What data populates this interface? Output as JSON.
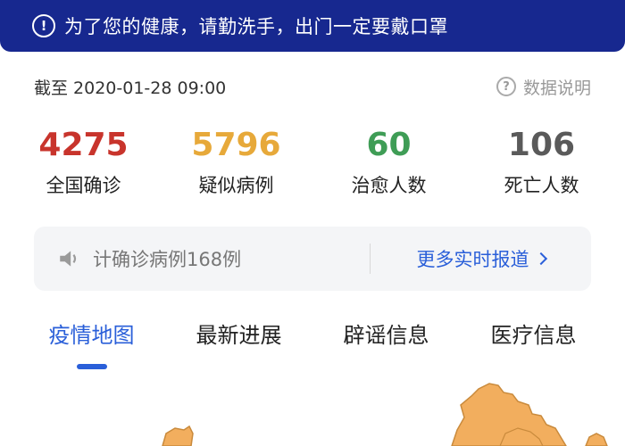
{
  "banner": {
    "icon": "exclamation-circle-icon",
    "text": "为了您的健康，请勤洗手，出门一定要戴口罩"
  },
  "meta": {
    "updated": "截至 2020-01-28 09:00",
    "explain_label": "数据说明"
  },
  "stats": [
    {
      "value": "4275",
      "label": "全国确诊",
      "color": "#c8342c"
    },
    {
      "value": "5796",
      "label": "疑似病例",
      "color": "#e7a93a"
    },
    {
      "value": "60",
      "label": "治愈人数",
      "color": "#3f9d56"
    },
    {
      "value": "106",
      "label": "死亡人数",
      "color": "#5a5a5a"
    }
  ],
  "ticker": {
    "text": "计确诊病例168例",
    "more_label": "更多实时报道"
  },
  "tabs": [
    {
      "label": "疫情地图",
      "active": true
    },
    {
      "label": "最新进展",
      "active": false
    },
    {
      "label": "辟谣信息",
      "active": false
    },
    {
      "label": "医疗信息",
      "active": false
    }
  ],
  "colors": {
    "banner_bg": "#17288f",
    "accent": "#2a5fd9",
    "map_fill": "#f2ae5e",
    "map_stroke": "#c98a3c"
  }
}
